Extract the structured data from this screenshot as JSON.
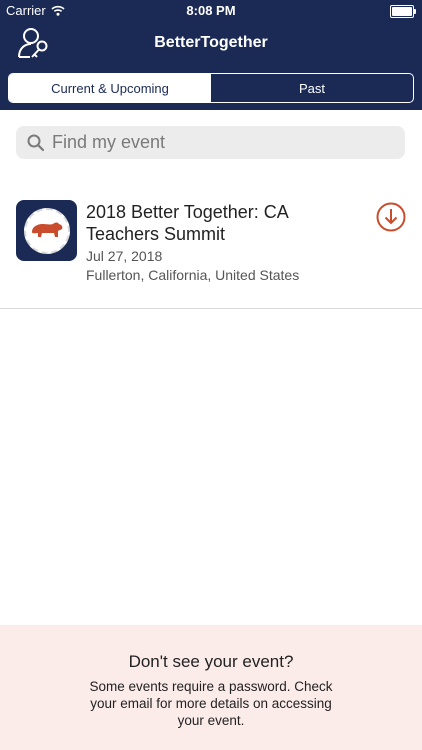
{
  "status": {
    "carrier": "Carrier",
    "time": "8:08 PM"
  },
  "nav": {
    "title": "BetterTogether"
  },
  "tabs": [
    {
      "label": "Current & Upcoming",
      "active": true
    },
    {
      "label": "Past",
      "active": false
    }
  ],
  "search": {
    "placeholder": "Find my event",
    "value": ""
  },
  "events": [
    {
      "title": "2018 Better Together: CA Teachers Summit",
      "date": "Jul 27, 2018",
      "location": "Fullerton, California, United States",
      "logo_icon": "bear-icon"
    }
  ],
  "footer": {
    "title": "Don't see your event?",
    "body": "Some events require a password. Check your email for more details on accessing your event."
  },
  "colors": {
    "brand": "#1a2a55",
    "accent": "#c94d2d",
    "footer_bg": "#fbecea"
  }
}
